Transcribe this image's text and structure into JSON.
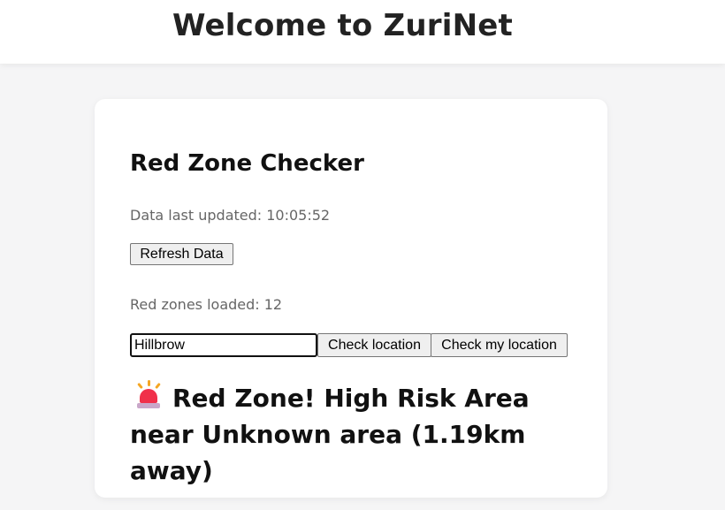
{
  "header": {
    "title": "Welcome to ZuriNet"
  },
  "card": {
    "title": "Red Zone Checker",
    "last_updated": "Data last updated: 10:05:52",
    "refresh_label": "Refresh Data",
    "zones_loaded": "Red zones loaded: 12",
    "search": {
      "value": "Hillbrow",
      "placeholder": ""
    },
    "check_location_label": "Check location",
    "check_my_location_label": "Check my location",
    "result": {
      "icon": "police-siren-icon",
      "text": "Red Zone! High Risk Area near Unknown area (1.19km away)"
    }
  },
  "colors": {
    "alert_red": "#f0304a",
    "background": "#f5f5f6",
    "card": "#ffffff"
  }
}
